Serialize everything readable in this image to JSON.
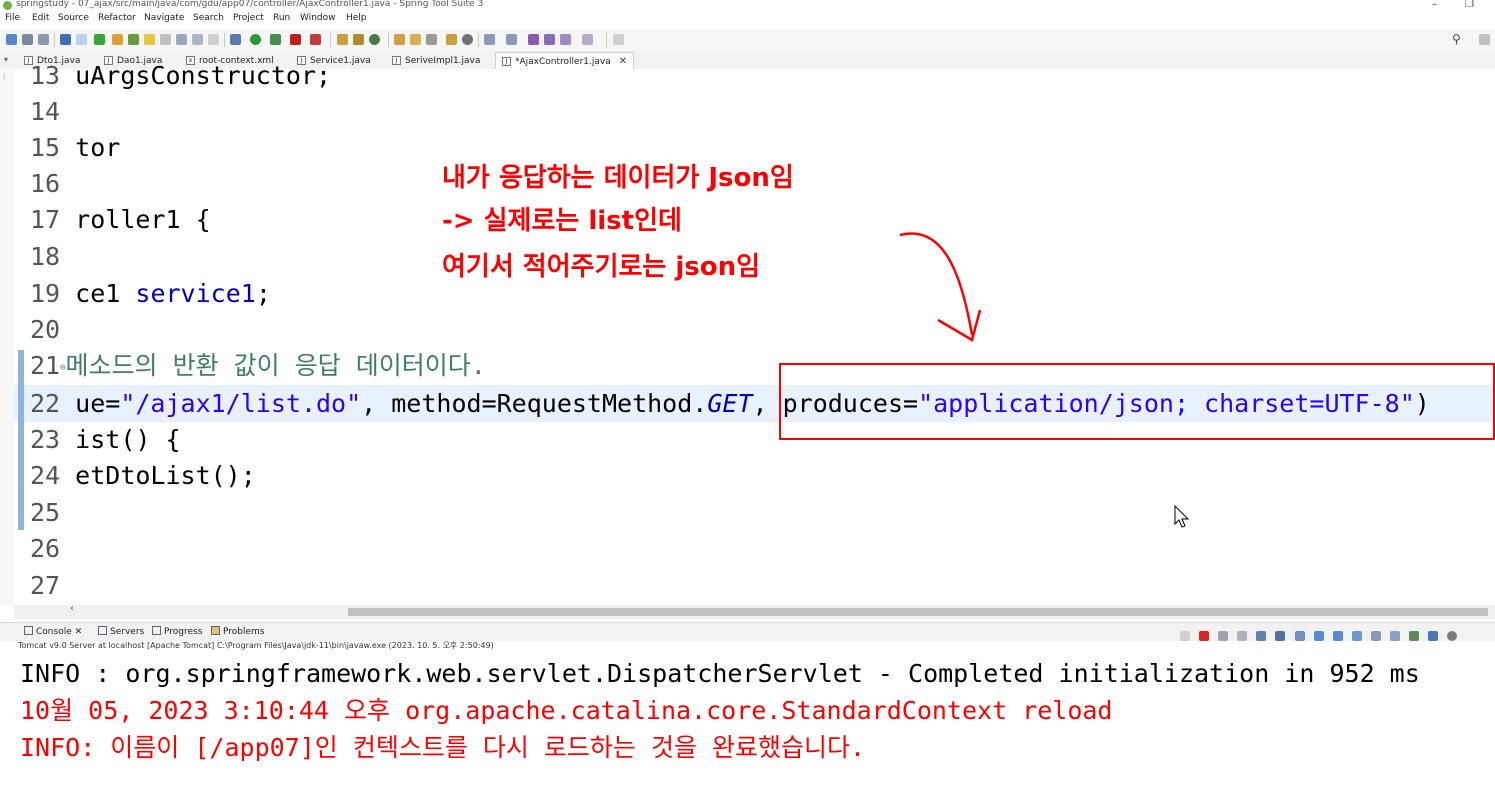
{
  "window": {
    "title": "springstudy - 07_ajax/src/main/java/com/gdu/app07/controller/AjaxController1.java - Spring Tool Suite 3",
    "minimize": "–",
    "restore": "❐"
  },
  "menu": [
    "File",
    "Edit",
    "Source",
    "Refactor",
    "Navigate",
    "Search",
    "Project",
    "Run",
    "Window",
    "Help"
  ],
  "tabs": [
    {
      "label": "Dto1.java",
      "icon": "java-file-icon"
    },
    {
      "label": "Dao1.java",
      "icon": "java-file-icon"
    },
    {
      "label": "root-context.xml",
      "icon": "xml-file-icon"
    },
    {
      "label": "Service1.java",
      "icon": "java-file-icon"
    },
    {
      "label": "SeriveImpl1.java",
      "icon": "java-file-icon"
    },
    {
      "label": "*AjaxController1.java",
      "icon": "java-file-icon",
      "active": true
    }
  ],
  "editor": {
    "lines": [
      {
        "n": "13",
        "text": "uArgsConstructor;"
      },
      {
        "n": "14",
        "text": ""
      },
      {
        "n": "15",
        "text": "tor"
      },
      {
        "n": "16",
        "text": ""
      },
      {
        "n": "17",
        "text": "roller1 {"
      },
      {
        "n": "18",
        "text": ""
      },
      {
        "n": "19",
        "text": "ce1 ",
        "field": "service1",
        "tail": ";"
      },
      {
        "n": "20",
        "text": ""
      },
      {
        "n": "21",
        "comment": "메소드의 반환 값이 응답 데이터이다."
      },
      {
        "n": "22",
        "pre": "ue=",
        "s1": "\"/ajax1/list.do\"",
        "mid": ", method=RequestMethod.",
        "italic": "GET",
        "mid2": ", produces=",
        "s2": "\"application/json; charset=UTF-8\"",
        "tail": ")"
      },
      {
        "n": "23",
        "text": "ist() {"
      },
      {
        "n": "24",
        "text": "etDtoList();"
      },
      {
        "n": "25",
        "text": ""
      },
      {
        "n": "26",
        "text": ""
      },
      {
        "n": "27",
        "text": ""
      }
    ]
  },
  "annotation": {
    "line1": "내가 응답하는 데이터가 Json임",
    "line2": "-> 실제로는 list인데",
    "line3": "여기서 적어주기로는 json임",
    "color": "#ff0000"
  },
  "console": {
    "tabs": [
      "Console",
      "Servers",
      "Progress",
      "Problems"
    ],
    "status": "Tomcat v9.0 Server at localhost [Apache Tomcat] C:\\Program Files\\Java\\jdk-11\\bin\\javaw.exe  (2023. 10. 5. 오후 2:50:49)",
    "lines": [
      {
        "text": "INFO : org.springframework.web.servlet.DispatcherServlet - Completed initialization in 952 ms",
        "color": "#000000"
      },
      {
        "text": "10월 05, 2023 3:10:44 오후 org.apache.catalina.core.StandardContext reload",
        "color": "#ff0000"
      },
      {
        "text": "INFO: 이름이 [/app07]인 컨텍스트를 다시 로드하는 것을 완료했습니다.",
        "color": "#ff0000"
      }
    ]
  }
}
